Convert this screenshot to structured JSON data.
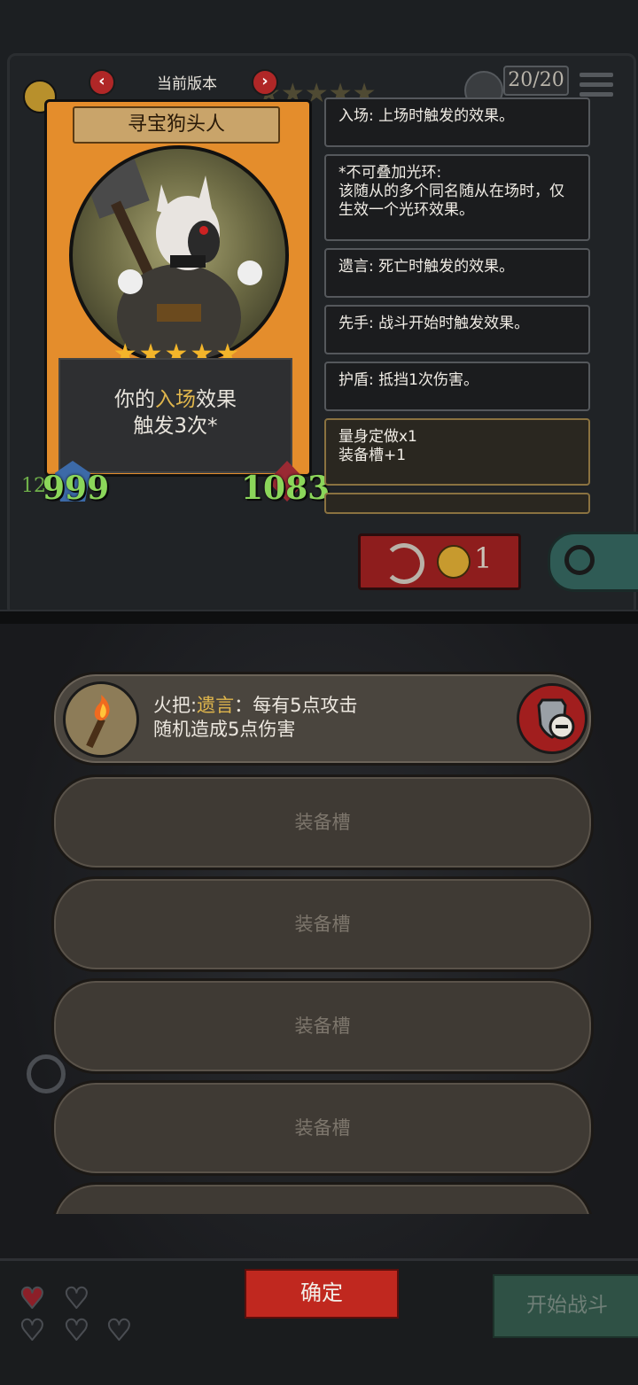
{
  "version_bar": {
    "label": "当前版本",
    "prev_icon": "chevron-left-icon",
    "next_icon": "chevron-right-icon"
  },
  "top_hud": {
    "board_count": "20/20"
  },
  "card": {
    "name": "寻宝狗头人",
    "stars": 5,
    "effect_prefix": "你的",
    "effect_highlight": "入场",
    "effect_suffix": "效果",
    "effect_line2": "触发3次*",
    "attack": "999",
    "health": "1083",
    "side_number": "12"
  },
  "tooltips": [
    {
      "text": "入场: 上场时触发的效果。"
    },
    {
      "text": "*不可叠加光环:\n该随从的多个同名随从在场时，仅生效一个光环效果。"
    },
    {
      "text": "遗言: 死亡时触发的效果。"
    },
    {
      "text": "先手: 战斗开始时触发效果。"
    },
    {
      "text": "护盾: 抵挡1次伤害。"
    },
    {
      "text": "量身定做x1\n装备槽+1"
    }
  ],
  "refresh": {
    "cost": "1"
  },
  "equipment": {
    "filled": {
      "name": "火把",
      "keyword": "遗言",
      "line1_rest": "：每有5点攻击",
      "line2": "随机造成5点伤害"
    },
    "empty_slot_label": "装备槽",
    "empty_slots": [
      "装备槽",
      "装备槽",
      "装备槽",
      "装备槽"
    ]
  },
  "footer": {
    "confirm_label": "确定",
    "start_battle_label": "开始战斗"
  },
  "colors": {
    "accent_red": "#c0281f",
    "keyword_gold": "#e0b64c",
    "stat_green": "#8bd65a"
  }
}
